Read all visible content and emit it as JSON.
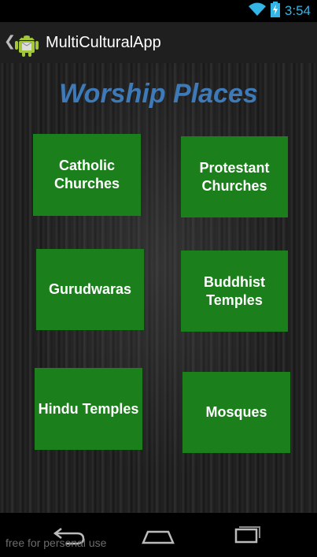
{
  "status_bar": {
    "time": "3:54",
    "icons": [
      "wifi-icon",
      "battery-charging-icon"
    ],
    "accent_color": "#33b5e5"
  },
  "action_bar": {
    "title": "MultiCulturalApp",
    "icon": "android-app-icon"
  },
  "main": {
    "heading": "Worship Places",
    "tile_color": "#1b7f1b",
    "heading_color": "#3d7ab7",
    "tiles": [
      {
        "label": "Catholic\nChurches"
      },
      {
        "label": "Protestant\nChurches"
      },
      {
        "label": "Gurudwaras"
      },
      {
        "label": "Buddhist\nTemples"
      },
      {
        "label": "Hindu Temples"
      },
      {
        "label": "Mosques"
      }
    ]
  },
  "nav_bar": {
    "buttons": [
      "back-icon",
      "home-icon",
      "recent-apps-icon"
    ],
    "watermark": "free for personal use"
  }
}
